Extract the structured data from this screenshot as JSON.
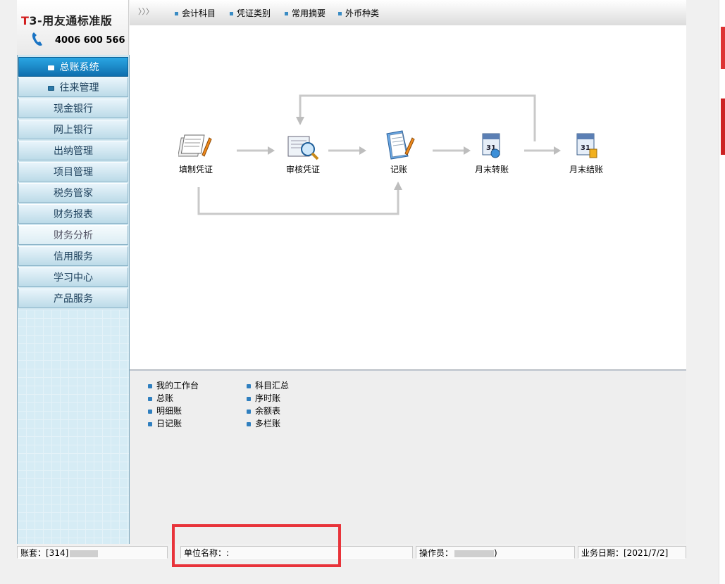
{
  "logo": {
    "brand_t": "T",
    "brand_rest": "3-用友通标准版",
    "phone": "4006 600 566"
  },
  "sidebar": {
    "items": [
      {
        "label": "总账系统"
      },
      {
        "label": "往来管理"
      },
      {
        "label": "现金银行"
      },
      {
        "label": "网上银行"
      },
      {
        "label": "出纳管理"
      },
      {
        "label": "项目管理"
      },
      {
        "label": "税务管家"
      },
      {
        "label": "财务报表"
      },
      {
        "label": "财务分析"
      },
      {
        "label": "信用服务"
      },
      {
        "label": "学习中心"
      },
      {
        "label": "产品服务"
      }
    ]
  },
  "topbar": {
    "arrows": "〉〉〉",
    "links": [
      {
        "label": "会计科目"
      },
      {
        "label": "凭证类别"
      },
      {
        "label": "常用摘要"
      },
      {
        "label": "外币种类"
      }
    ]
  },
  "flow": {
    "nodes": [
      {
        "label": "填制凭证",
        "icon": "fill-voucher-icon"
      },
      {
        "label": "审核凭证",
        "icon": "audit-voucher-icon"
      },
      {
        "label": "记账",
        "icon": "bookkeeping-icon"
      },
      {
        "label": "月末转账",
        "icon": "month-end-transfer-icon"
      },
      {
        "label": "月末结账",
        "icon": "month-end-close-icon"
      }
    ]
  },
  "bottom_links": {
    "col1": [
      {
        "label": "我的工作台"
      },
      {
        "label": "总账"
      },
      {
        "label": "明细账"
      },
      {
        "label": "日记账"
      }
    ],
    "col2": [
      {
        "label": "科目汇总"
      },
      {
        "label": "序时账"
      },
      {
        "label": "余额表"
      },
      {
        "label": "多栏账"
      }
    ]
  },
  "status": {
    "account": "账套：[314]",
    "account_tail": "",
    "unit": "单位名称：:",
    "operator": "操作员：",
    "operator_tail": ")",
    "date": "业务日期：[2021/7/2]"
  },
  "colors": {
    "accent": "#0f6fae",
    "highlight": "#e8333a",
    "sidebar_bg": "#cfe6f0"
  }
}
